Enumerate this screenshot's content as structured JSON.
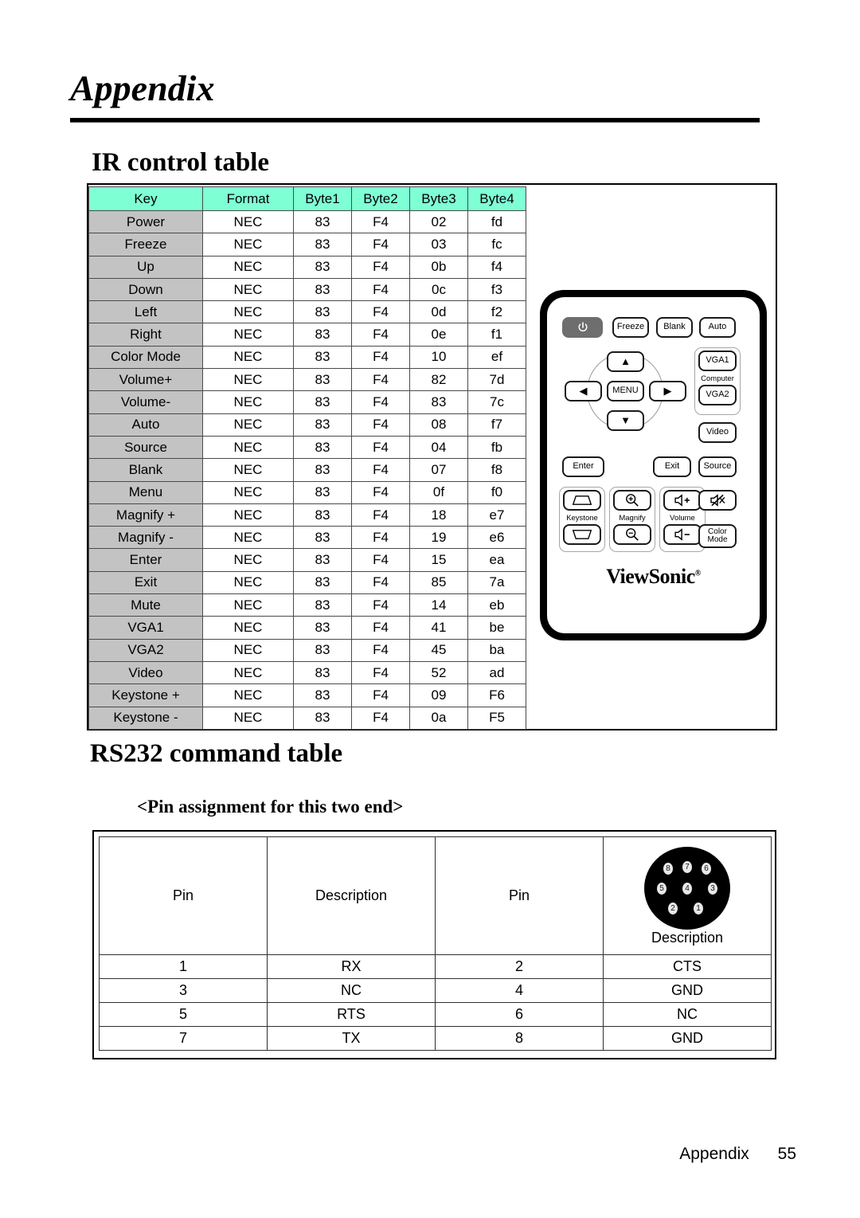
{
  "document": {
    "chapter_title": "Appendix",
    "footer_label": "Appendix",
    "footer_page": "55"
  },
  "ir_section": {
    "heading": "IR control table",
    "table": {
      "columns": [
        "Key",
        "Format",
        "Byte1",
        "Byte2",
        "Byte3",
        "Byte4"
      ],
      "rows": [
        [
          "Power",
          "NEC",
          "83",
          "F4",
          "02",
          "fd"
        ],
        [
          "Freeze",
          "NEC",
          "83",
          "F4",
          "03",
          "fc"
        ],
        [
          "Up",
          "NEC",
          "83",
          "F4",
          "0b",
          "f4"
        ],
        [
          "Down",
          "NEC",
          "83",
          "F4",
          "0c",
          "f3"
        ],
        [
          "Left",
          "NEC",
          "83",
          "F4",
          "0d",
          "f2"
        ],
        [
          "Right",
          "NEC",
          "83",
          "F4",
          "0e",
          "f1"
        ],
        [
          "Color Mode",
          "NEC",
          "83",
          "F4",
          "10",
          "ef"
        ],
        [
          "Volume+",
          "NEC",
          "83",
          "F4",
          "82",
          "7d"
        ],
        [
          "Volume-",
          "NEC",
          "83",
          "F4",
          "83",
          "7c"
        ],
        [
          "Auto",
          "NEC",
          "83",
          "F4",
          "08",
          "f7"
        ],
        [
          "Source",
          "NEC",
          "83",
          "F4",
          "04",
          "fb"
        ],
        [
          "Blank",
          "NEC",
          "83",
          "F4",
          "07",
          "f8"
        ],
        [
          "Menu",
          "NEC",
          "83",
          "F4",
          "0f",
          "f0"
        ],
        [
          "Magnify +",
          "NEC",
          "83",
          "F4",
          "18",
          "e7"
        ],
        [
          "Magnify -",
          "NEC",
          "83",
          "F4",
          "19",
          "e6"
        ],
        [
          "Enter",
          "NEC",
          "83",
          "F4",
          "15",
          "ea"
        ],
        [
          "Exit",
          "NEC",
          "83",
          "F4",
          "85",
          "7a"
        ],
        [
          "Mute",
          "NEC",
          "83",
          "F4",
          "14",
          "eb"
        ],
        [
          "VGA1",
          "NEC",
          "83",
          "F4",
          "41",
          "be"
        ],
        [
          "VGA2",
          "NEC",
          "83",
          "F4",
          "45",
          "ba"
        ],
        [
          "Video",
          "NEC",
          "83",
          "F4",
          "52",
          "ad"
        ],
        [
          "Keystone +",
          "NEC",
          "83",
          "F4",
          "09",
          "F6"
        ],
        [
          "Keystone -",
          "NEC",
          "83",
          "F4",
          "0a",
          "F5"
        ]
      ]
    }
  },
  "remote": {
    "brand": "ViewSonic",
    "buttons": {
      "power": "power-icon",
      "freeze": "Freeze",
      "blank": "Blank",
      "auto": "Auto",
      "up": "▲",
      "down": "▼",
      "left": "◀",
      "right": "▶",
      "menu": "MENU",
      "vga1": "VGA1",
      "vga2": "VGA2",
      "video": "Video",
      "enter": "Enter",
      "exit": "Exit",
      "source": "Source",
      "color_mode": "Color\nMode"
    },
    "group_labels": {
      "computer": "Computer",
      "keystone": "Keystone",
      "magnify": "Magnify",
      "volume": "Volume"
    }
  },
  "rs232_section": {
    "heading": "RS232 command table",
    "sub_heading": "<Pin assignment for this two end>",
    "table": {
      "headers": [
        "Pin",
        "Description",
        "Pin",
        "Description"
      ],
      "rows": [
        [
          "1",
          "RX",
          "2",
          "CTS"
        ],
        [
          "3",
          "NC",
          "4",
          "GND"
        ],
        [
          "5",
          "RTS",
          "6",
          "NC"
        ],
        [
          "7",
          "TX",
          "8",
          "GND"
        ]
      ]
    },
    "connector": {
      "pin_numbers": [
        "8",
        "7",
        "6",
        "5",
        "4",
        "3",
        "2",
        "1"
      ]
    }
  },
  "colors": {
    "table_header_bg": "#7FFFD4",
    "key_column_bg": "#C3C3C3",
    "text": "#000000",
    "power_button_bg": "#6E6E6E"
  }
}
